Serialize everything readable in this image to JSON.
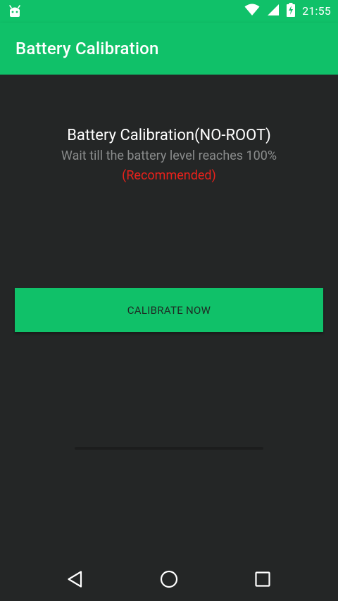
{
  "status_bar": {
    "time": "21:55",
    "icons": [
      "android-icon",
      "wifi-icon",
      "cell-signal-icon",
      "battery-charging-icon"
    ]
  },
  "app_bar": {
    "title": "Battery Calibration"
  },
  "main": {
    "heading": "Battery Calibration(NO-ROOT)",
    "instruction": "Wait till the battery level reaches 100%",
    "recommendation": "(Recommended)",
    "calibrate_button": "CALIBRATE NOW"
  },
  "nav_bar": {
    "buttons": [
      "back-icon",
      "home-icon",
      "recents-icon"
    ]
  },
  "colors": {
    "accent": "#10c169",
    "background": "#242626",
    "text_primary": "#ffffff",
    "text_secondary": "#8a8c8c",
    "warning": "#e8211b"
  }
}
